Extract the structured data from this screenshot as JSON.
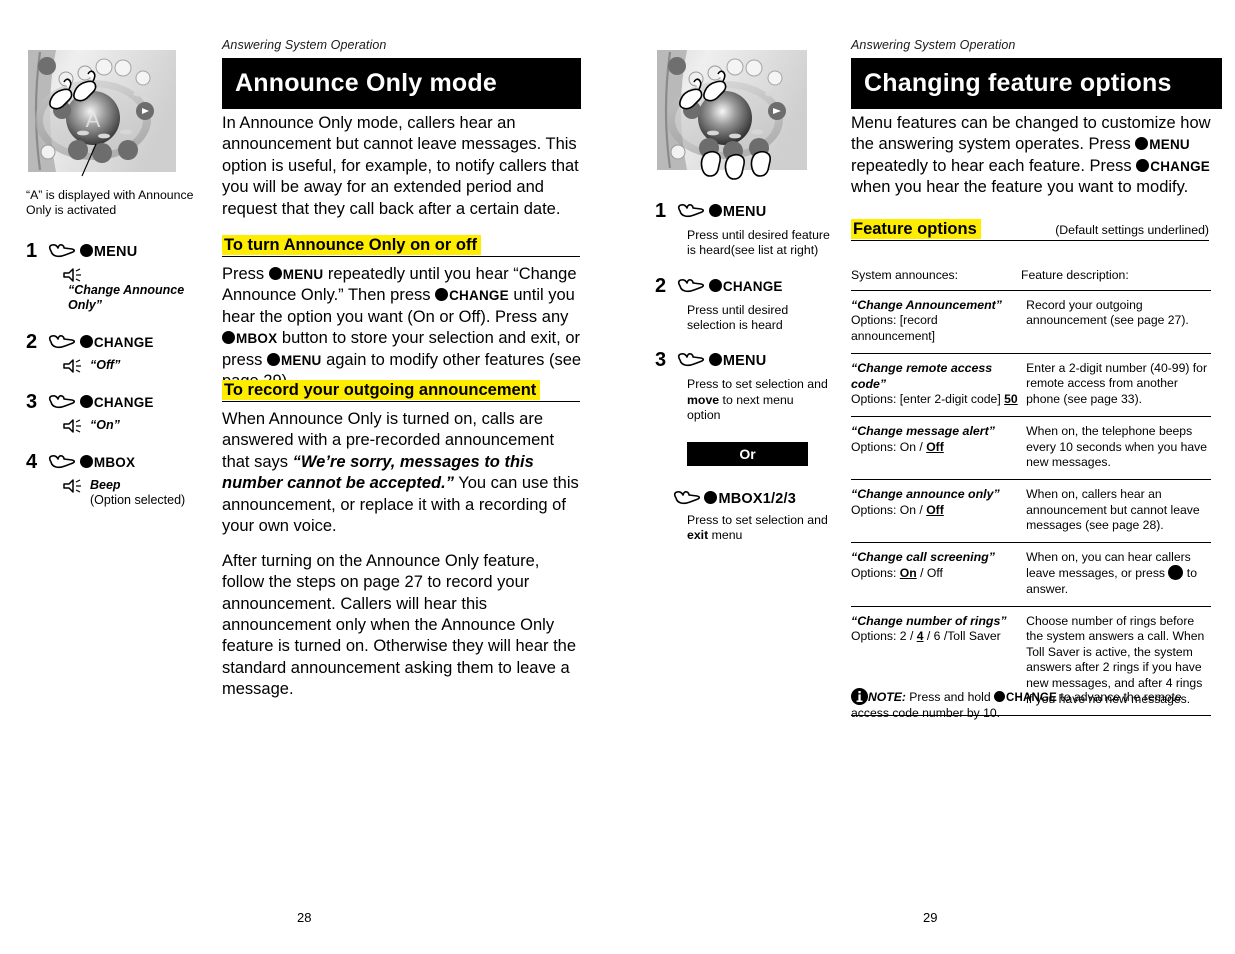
{
  "left_page": {
    "running_head": "Answering System Operation",
    "banner_title": "Announce Only mode",
    "intro": "In Announce Only mode, callers hear an announcement but cannot leave messages. This option is useful, for example, to notify callers that you will be away for an extended period and request that they call back after a certain date.",
    "illustration_caption": "“A” is displayed with Announce Only is activated",
    "section1": {
      "heading": "To turn Announce Only on or off",
      "text_parts": {
        "p1": "Press ",
        "b1": "MENU",
        "p2": " repeatedly until you hear “Change Announce Only.” Then press ",
        "b2": "CHANGE",
        "p3": " until you hear the option you want (On or Off). Press any ",
        "b3": "MBOX",
        "p4": " button to store your selection and exit, or press ",
        "b4": "MENU",
        "p5": " again to modify other features (see page 29)."
      }
    },
    "section2": {
      "heading": "To record your outgoing announcement",
      "para1_a": "When Announce Only is turned on, calls are answered with a pre-recorded announcement  that says ",
      "para1_quote": "“We’re sorry, messages to this number cannot be accepted.”",
      "para1_b": " You can use this announcement, or replace it with a recording of your own voice.",
      "para2": "After turning on the Announce Only feature, follow the steps on page 27 to record your announcement. Callers will hear this announcement only when the Announce Only feature is turned on. Otherwise they will hear the standard announcement asking them to leave a message."
    },
    "steps": [
      {
        "num": "1",
        "button": "MENU",
        "speech": "“Change Announce Only”",
        "has_speaker": true
      },
      {
        "num": "2",
        "button": "CHANGE",
        "speech": "“Off”",
        "has_speaker": true
      },
      {
        "num": "3",
        "button": "CHANGE",
        "speech": "“On”",
        "has_speaker": true
      },
      {
        "num": "4",
        "button": "MBOX",
        "speech": "Beep",
        "speech2": "(Option selected)",
        "has_speaker": true
      }
    ],
    "folio": "28"
  },
  "right_page": {
    "running_head": "Answering System Operation",
    "banner_title": "Changing feature options",
    "intro_parts": {
      "p1": "Menu features can be changed to customize how the answering system operates. Press ",
      "b1": "MENU",
      "p2": " repeatedly to hear each feature. Press ",
      "b2": "CHANGE",
      "p3": " when you hear the feature you want to modify."
    },
    "feature_heading": "Feature options",
    "feature_note": "(Default settings underlined)",
    "steps": [
      {
        "num": "1",
        "button": "MENU",
        "desc": "Press until desired feature is heard(see list at right)"
      },
      {
        "num": "2",
        "button": "CHANGE",
        "desc": "Press until desired selection is heard"
      },
      {
        "num": "3",
        "button": "MENU",
        "desc_a": "Press to set selection and ",
        "desc_b": "move",
        "desc_c": " to next menu option"
      }
    ],
    "or_label": "Or",
    "alt_step": {
      "button": "MBOX1/2/3",
      "desc_a": "Press to set selection and ",
      "desc_b": "exit",
      "desc_c": " menu"
    },
    "table": {
      "col1_header": "System announces:",
      "col2_header": "Feature description:",
      "rows": [
        {
          "name": "“Change Announcement”",
          "options": "Options: [record announcement]",
          "options_default": "",
          "desc": "Record your outgoing announcement (see page 27)."
        },
        {
          "name": "“Change remote access code”",
          "options": "Options: [enter 2-digit code] ",
          "options_default": "50",
          "desc": "Enter a 2-digit number (40-99) for remote access from another phone (see page 33)."
        },
        {
          "name": "“Change message alert”",
          "options": "Options: On / ",
          "options_default": "Off",
          "desc": "When on, the telephone beeps every 10 seconds when you have new messages."
        },
        {
          "name": "“Change announce only”",
          "options": "Options: On / ",
          "options_default": "Off",
          "desc": "When on, callers hear an announcement but cannot leave messages (see page 28)."
        },
        {
          "name": "“Change call screening”",
          "options_pre": "Options: ",
          "options_default": "On",
          "options_post": " / Off",
          "desc_a": "When on, you can hear callers leave messages, or press ",
          "desc_icon": "menu-button-icon",
          "desc_b": " to answer."
        },
        {
          "name": "“Change number of rings”",
          "options_pre": "Options: 2 / ",
          "options_default": "4",
          "options_post": " / 6 /Toll Saver",
          "desc": "Choose number of rings before the system answers a call. When Toll Saver is active, the system answers after 2 rings if you have new messages, and after 4 rings if you have no new messages."
        }
      ]
    },
    "note": {
      "label": "NOTE:",
      "text_a": " Press and hold ",
      "button": "CHANGE",
      "text_b": " to advance the remote access code number by 10."
    },
    "folio": "29"
  },
  "colors": {
    "highlight": "#ffed00",
    "banner_bg": "#000000",
    "text": "#000000"
  }
}
